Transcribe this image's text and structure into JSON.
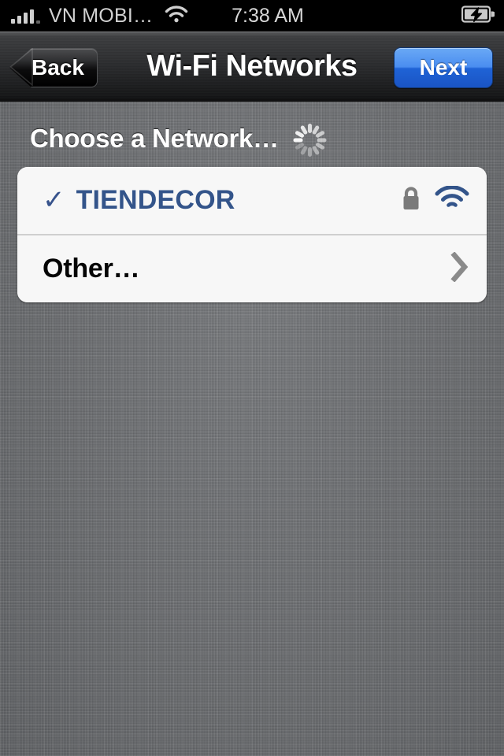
{
  "status_bar": {
    "carrier": "VN MOBI…",
    "time": "7:38 AM",
    "signal_bars_total": 5,
    "signal_bars_filled": 4,
    "wifi_icon": "wifi-icon",
    "battery_icon": "battery-charging-icon",
    "battery_charging": true
  },
  "nav_bar": {
    "back_label": "Back",
    "title": "Wi-Fi Networks",
    "next_label": "Next",
    "next_color": "#2f7ae5"
  },
  "section": {
    "header": "Choose a Network…",
    "spinner_visible": true,
    "spinner_name": "activity-indicator"
  },
  "networks": [
    {
      "ssid": "TIENDECOR",
      "selected": true,
      "checkmark": "✓",
      "secured": true,
      "lock_icon": "lock-icon",
      "signal_icon": "wifi-signal-icon",
      "accent_color": "#33548a"
    }
  ],
  "other_row": {
    "label": "Other…",
    "chevron_icon": "chevron-right-icon"
  }
}
